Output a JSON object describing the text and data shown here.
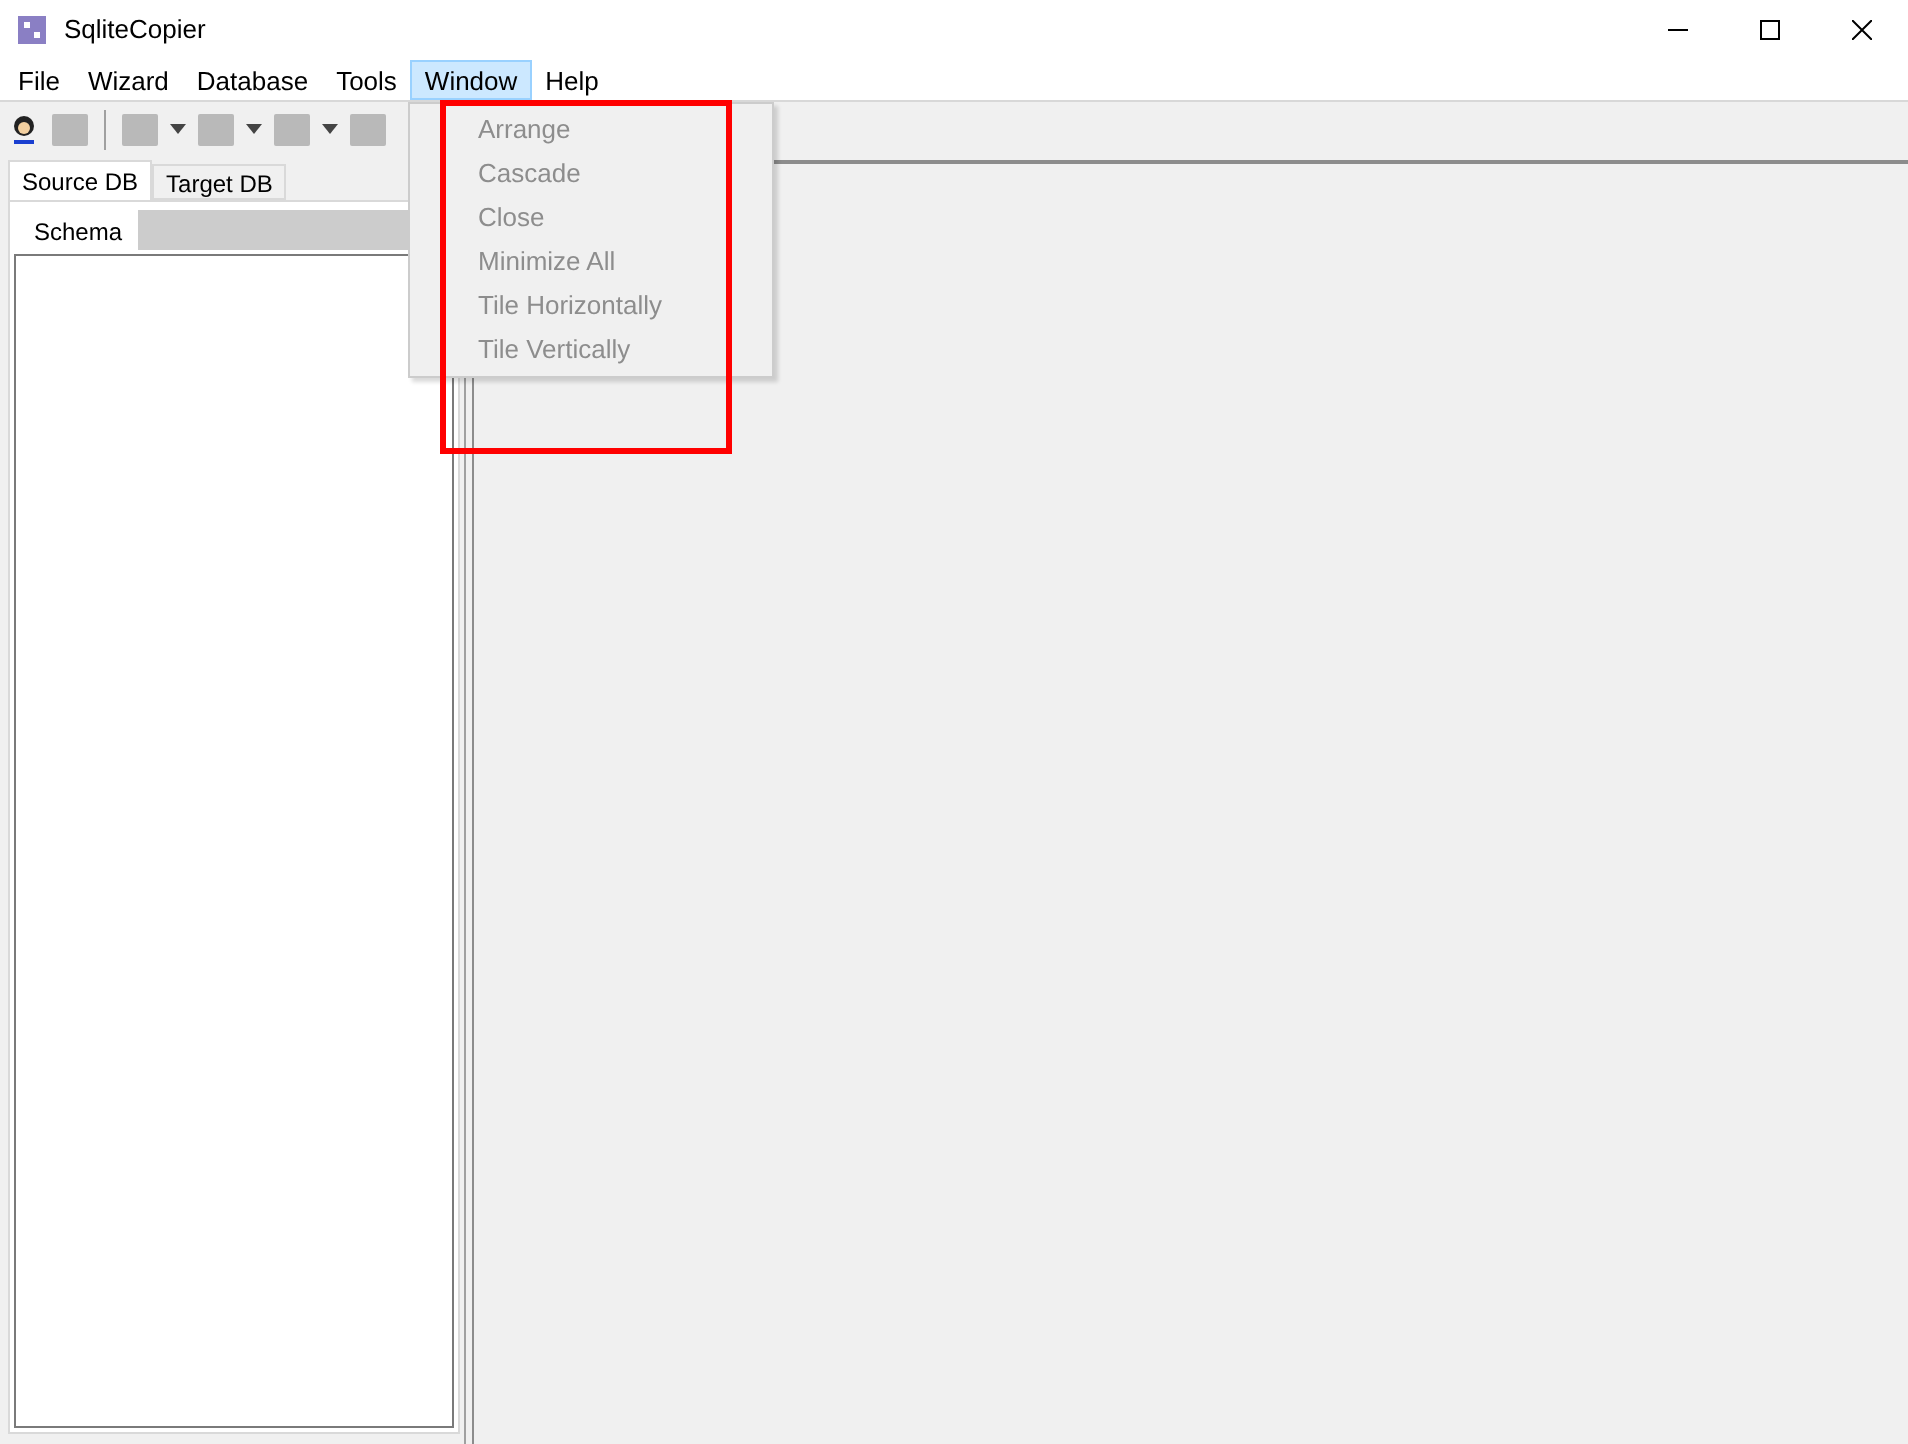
{
  "window": {
    "title": "SqliteCopier"
  },
  "menu": [
    {
      "label": "File",
      "selected": false
    },
    {
      "label": "Wizard",
      "selected": false
    },
    {
      "label": "Database",
      "selected": false
    },
    {
      "label": "Tools",
      "selected": false
    },
    {
      "label": "Window",
      "selected": true
    },
    {
      "label": "Help",
      "selected": false
    }
  ],
  "window_menu": [
    {
      "label": "Arrange",
      "disabled": true
    },
    {
      "label": "Cascade",
      "disabled": true
    },
    {
      "label": "Close",
      "disabled": true
    },
    {
      "label": "Minimize All",
      "disabled": true
    },
    {
      "label": "Tile Horizontally",
      "disabled": true
    },
    {
      "label": "Tile Vertically",
      "disabled": true
    }
  ],
  "tabs": [
    {
      "label": "Source DB",
      "selected": true
    },
    {
      "label": "Target DB",
      "selected": false
    }
  ],
  "subtabs": [
    {
      "label": "Schema",
      "selected": true
    }
  ]
}
